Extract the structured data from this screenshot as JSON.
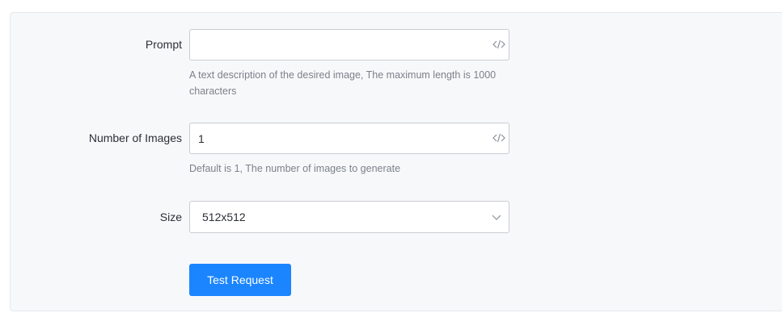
{
  "form": {
    "prompt": {
      "label": "Prompt",
      "value": "",
      "help": "A text description of the desired image, The maximum length is 1000 characters"
    },
    "num_images": {
      "label": "Number of Images",
      "value": "1",
      "help": "Default is 1, The number of images to generate"
    },
    "size": {
      "label": "Size",
      "selected": "512x512"
    },
    "submit_label": "Test Request"
  },
  "icons": {
    "code": "code-icon",
    "chevron": "chevron-down-icon"
  },
  "colors": {
    "accent": "#1a85ff",
    "panel_bg": "#f7f8fa",
    "help_text": "#7b818b"
  }
}
